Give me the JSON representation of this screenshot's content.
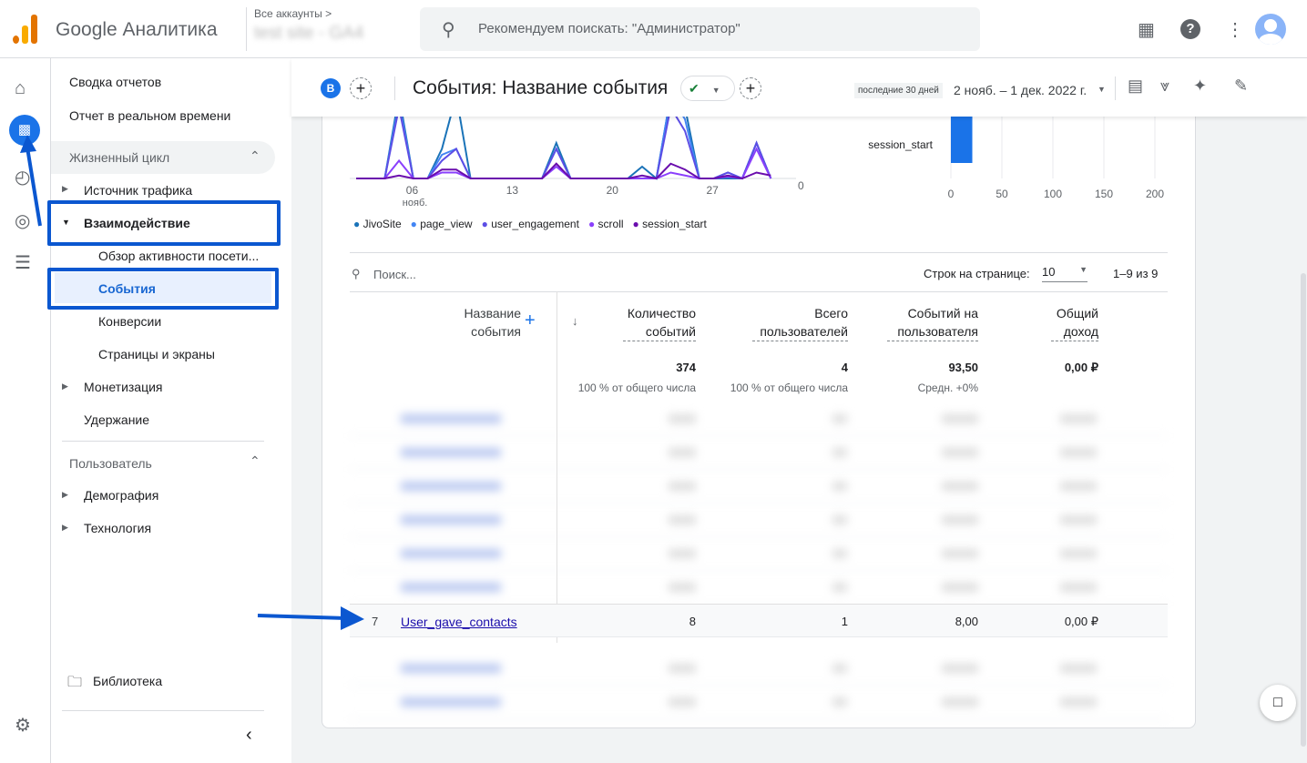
{
  "header": {
    "brand": "Google Аналитика",
    "accounts_label": "Все аккаунты >",
    "property": "test site - GA4",
    "search_placeholder": "Рекомендуем поискать: \"Администратор\"",
    "icons": [
      "apps-icon",
      "help-icon",
      "more-icon",
      "avatar"
    ]
  },
  "rail": {
    "icons": [
      "home-icon",
      "reports-icon",
      "explore-icon",
      "advertising-icon",
      "configure-icon"
    ],
    "settings_icon": "gear-icon"
  },
  "sidebar": {
    "top": [
      "Сводка отчетов",
      "Отчет в реальном времени"
    ],
    "lifecycle": "Жизненный цикл",
    "lifecycle_items": [
      "Источник трафика",
      "Взаимодействие",
      "Обзор активности посети...",
      "События",
      "Конверсии",
      "Страницы и экраны",
      "Монетизация",
      "Удержание"
    ],
    "user": "Пользователь",
    "user_items": [
      "Демография",
      "Технология"
    ],
    "library": "Библиотека"
  },
  "subheader": {
    "compare_badge": "B",
    "title": "События: Название события",
    "period_chip": "последние 30 дней",
    "date_range": "2 нояб. – 1 дек. 2022 г."
  },
  "chart_data": {
    "type": "line",
    "x": [
      "2 нояб.",
      "3",
      "4",
      "5",
      "6",
      "7",
      "8",
      "9",
      "10",
      "11",
      "12",
      "13",
      "14",
      "15",
      "16",
      "17",
      "18",
      "19",
      "20",
      "21",
      "22",
      "23",
      "24",
      "25",
      "26",
      "27",
      "28",
      "29",
      "30",
      "1 дек."
    ],
    "xticks": [
      "06",
      "13",
      "20",
      "27"
    ],
    "xtick_sub": "нояб.",
    "right_axis_tick": "0",
    "series": [
      {
        "name": "JivoSite",
        "color": "#1a73b8",
        "values": [
          0,
          0,
          0,
          14,
          0,
          0,
          5,
          14,
          0,
          0,
          0,
          0,
          0,
          0,
          6,
          0,
          0,
          0,
          0,
          0,
          2,
          0,
          14,
          12,
          0,
          0,
          0,
          0,
          6,
          0
        ]
      },
      {
        "name": "page_view",
        "color": "#4285f4",
        "values": [
          0,
          0,
          0,
          13,
          0,
          0,
          4,
          5,
          0,
          0,
          0,
          0,
          0,
          0,
          5,
          0,
          0,
          0,
          0,
          0,
          0,
          0,
          14,
          10,
          0,
          0,
          1,
          0,
          6,
          0
        ]
      },
      {
        "name": "user_engagement",
        "color": "#5c4ee5",
        "values": [
          0,
          0,
          0,
          12,
          0,
          0,
          3,
          5,
          0,
          0,
          0,
          0,
          0,
          0,
          5,
          0,
          0,
          0,
          0,
          0,
          0,
          0,
          12,
          8,
          0,
          0,
          1,
          0,
          6,
          0
        ]
      },
      {
        "name": "scroll",
        "color": "#8a3ffc",
        "values": [
          0,
          0,
          0,
          3,
          0,
          0,
          1,
          1,
          0,
          0,
          0,
          0,
          0,
          0,
          2,
          0,
          0,
          0,
          0,
          0,
          0,
          0,
          1,
          0.5,
          0,
          0,
          0.3,
          0,
          5,
          0
        ]
      },
      {
        "name": "session_start",
        "color": "#6a0dad",
        "values": [
          0,
          0,
          0,
          0.5,
          0,
          0,
          1.5,
          1.5,
          0,
          0,
          0,
          0,
          0,
          0,
          2.5,
          0,
          0,
          0,
          0,
          0,
          0.5,
          0,
          2.5,
          1.5,
          0,
          0,
          0.5,
          0,
          1,
          0.5
        ]
      }
    ],
    "bar": {
      "category": "session_start",
      "value": 21,
      "xticks": [
        "0",
        "50",
        "100",
        "150",
        "200"
      ]
    }
  },
  "table": {
    "search_placeholder": "Поиск...",
    "rows_per_page_label": "Строк на странице:",
    "rows_per_page": "10",
    "pagination": "1–9 из 9",
    "columns": [
      "Название события",
      "Количество событий",
      "Всего пользователей",
      "Событий на пользователя",
      "Общий доход"
    ],
    "totals": [
      "374",
      "4",
      "93,50",
      "0,00 ₽"
    ],
    "totals_sub": [
      "100 % от общего числа",
      "100 % от общего числа",
      "Средн. +0%"
    ],
    "visible_row": {
      "index": "7",
      "name": "User_gave_contacts",
      "values": [
        "8",
        "1",
        "8,00",
        "0,00 ₽"
      ]
    }
  }
}
